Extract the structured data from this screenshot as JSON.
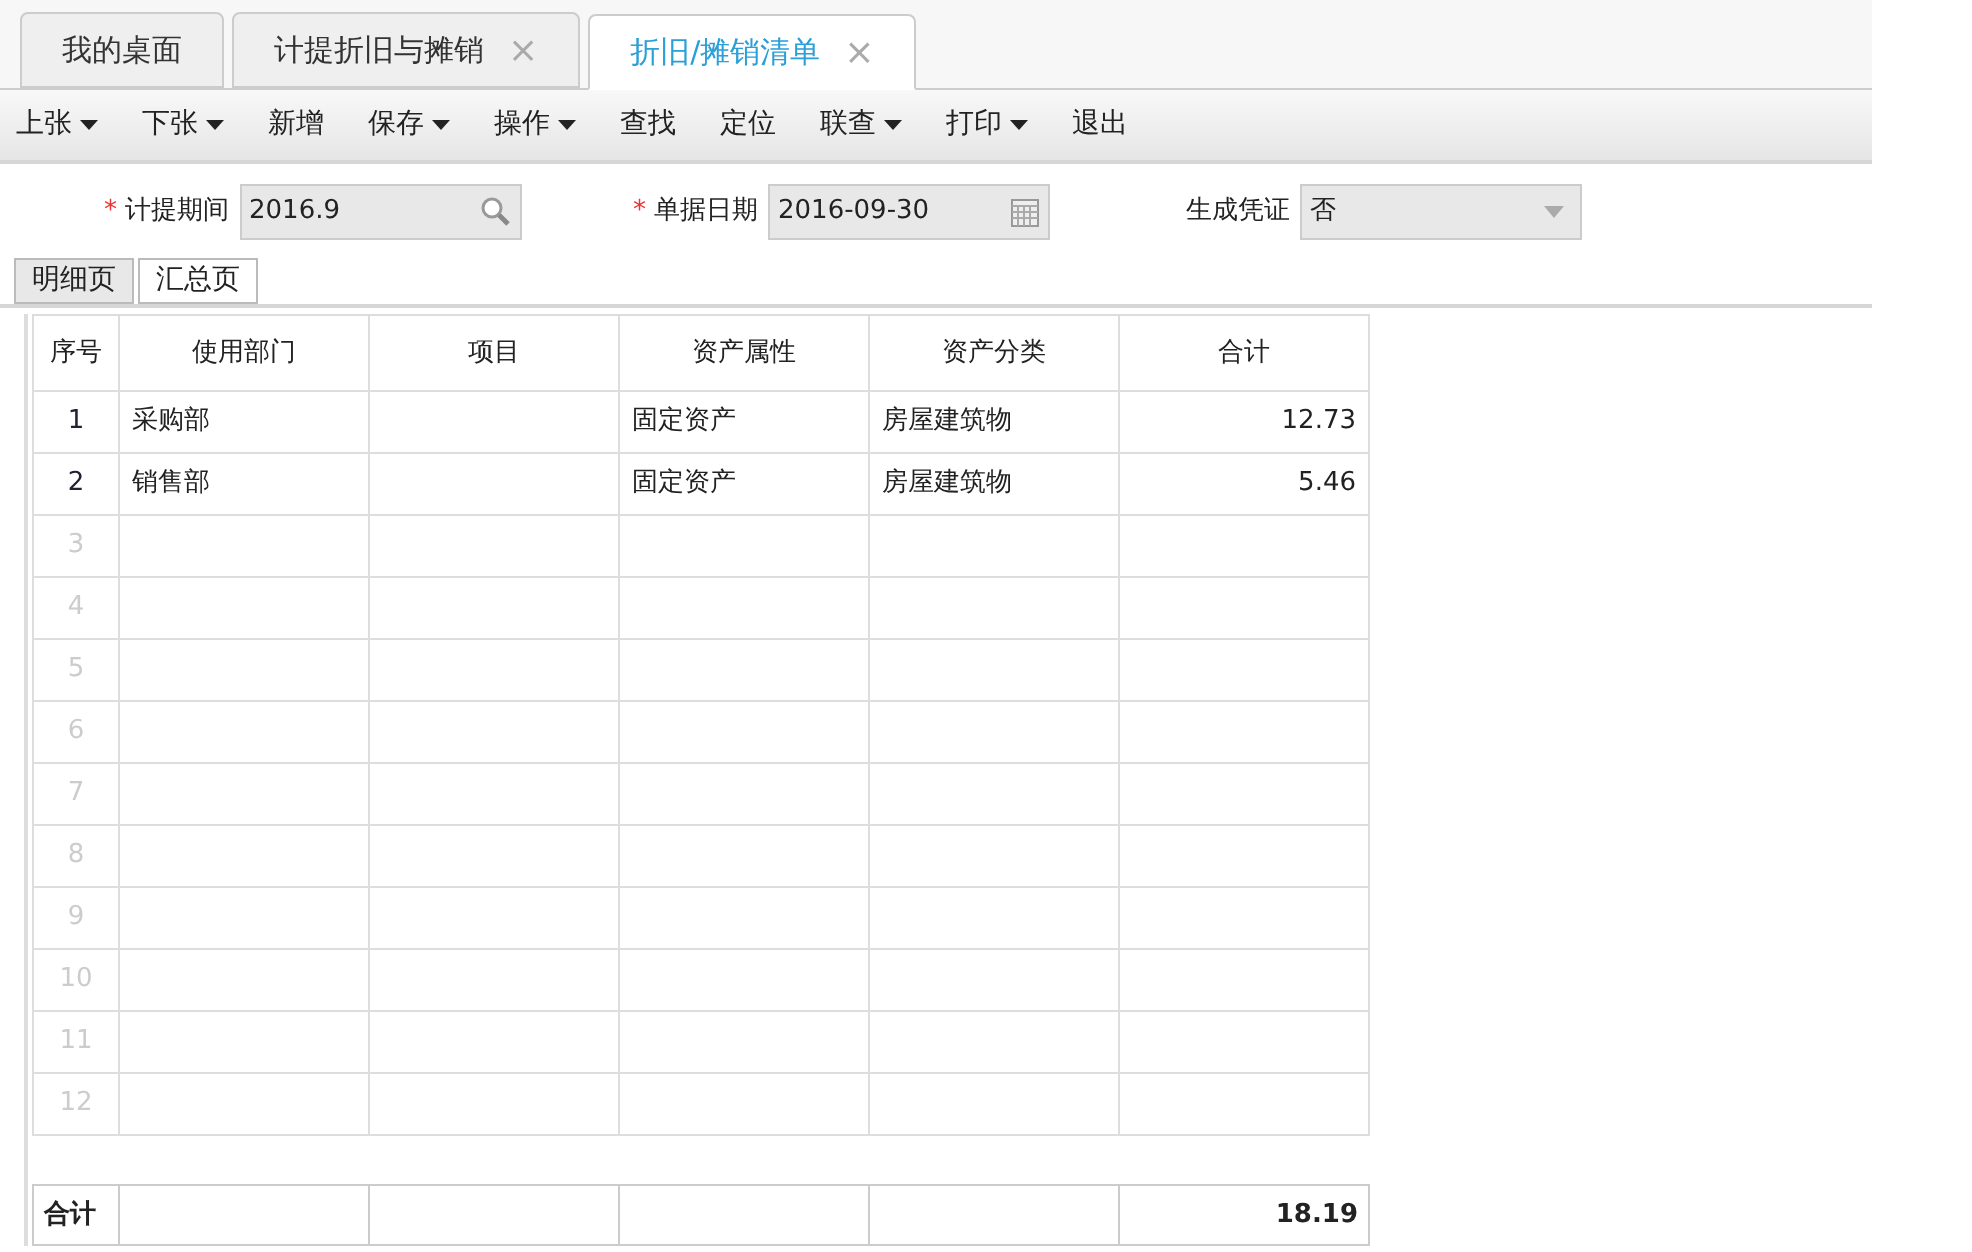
{
  "tabs": [
    {
      "label": "我的桌面",
      "selected": false
    },
    {
      "label": "计提折旧与摊销",
      "selected": false,
      "close": "×"
    },
    {
      "label": "折旧/摊销清单",
      "selected": true,
      "close": "×"
    }
  ],
  "toolbar": [
    {
      "label": "上张",
      "has_menu": true
    },
    {
      "label": "下张",
      "has_menu": true
    },
    {
      "label": "新增",
      "has_menu": false
    },
    {
      "label": "保存",
      "has_menu": true
    },
    {
      "label": "操作",
      "has_menu": true
    },
    {
      "label": "查找",
      "has_menu": false
    },
    {
      "label": "定位",
      "has_menu": false
    },
    {
      "label": "联查",
      "has_menu": true
    },
    {
      "label": "打印",
      "has_menu": true
    },
    {
      "label": "退出",
      "has_menu": false
    }
  ],
  "form": [
    {
      "kind": "lookup",
      "label": "计提期间",
      "required_mark": "*",
      "value": "2016.9"
    },
    {
      "kind": "date",
      "label": "单据日期",
      "required_mark": "*",
      "value": "2016-09-30"
    },
    {
      "kind": "select",
      "label": "生成凭证",
      "value": "否"
    }
  ],
  "sub_tabs": [
    {
      "label": "明细页",
      "selected": false
    },
    {
      "label": "汇总页",
      "selected": true
    }
  ],
  "table": {
    "columns": [
      "序号",
      "使用部门",
      "项目",
      "资产属性",
      "资产分类",
      "合计"
    ],
    "rows": [
      {
        "number": "1",
        "department": "采购部",
        "asset_property": "固定资产",
        "asset_category": "房屋建筑物",
        "total": "12.73"
      },
      {
        "number": "2",
        "department": "销售部",
        "asset_property": "固定资产",
        "asset_category": "房屋建筑物",
        "total": "5.46"
      },
      {
        "number": "3"
      },
      {
        "number": "4"
      },
      {
        "number": "5"
      },
      {
        "number": "6"
      },
      {
        "number": "7"
      },
      {
        "number": "8"
      },
      {
        "number": "9"
      },
      {
        "number": "10"
      },
      {
        "number": "11"
      },
      {
        "number": "12"
      }
    ],
    "footer": {
      "label": "合计",
      "total": "18.19"
    }
  }
}
